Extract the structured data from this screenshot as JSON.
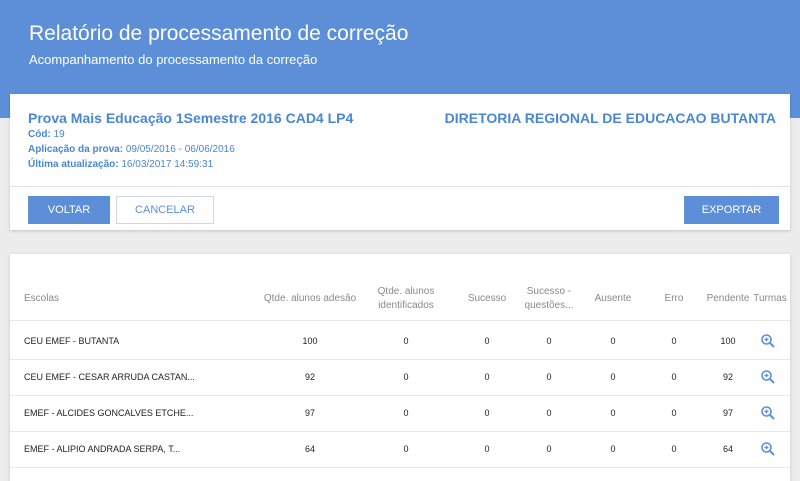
{
  "header": {
    "title": "Relatório de processamento de correção",
    "subtitle": "Acompanhamento do processamento da correção"
  },
  "exam": {
    "title": "Prova Mais Educação 1Semestre 2016 CAD4 LP4",
    "directorate": "DIRETORIA REGIONAL DE EDUCACAO BUTANTA",
    "code_label": "Cód:",
    "code_value": "19",
    "application_label": "Aplicação da prova:",
    "application_value": "09/05/2016 - 06/06/2016",
    "updated_label": "Última atualização:",
    "updated_value": "16/03/2017 14:59:31"
  },
  "actions": {
    "back_label": "VOLTAR",
    "cancel_label": "CANCELAR",
    "export_label": "EXPORTAR"
  },
  "table": {
    "columns": {
      "schools": "Escolas",
      "adhesion": "Qtde. alunos adesão",
      "identified": "Qtde. alunos identificados",
      "success": "Sucesso",
      "success_questions": "Sucesso - questões...",
      "absent": "Ausente",
      "error": "Erro",
      "pending": "Pendente",
      "classes": "Turmas"
    },
    "rows": [
      {
        "school": "CEU EMEF - BUTANTA",
        "adhesion": "100",
        "identified": "0",
        "success": "0",
        "success_questions": "0",
        "absent": "0",
        "error": "0",
        "pending": "100"
      },
      {
        "school": "CEU EMEF - CESAR ARRUDA CASTAN...",
        "adhesion": "92",
        "identified": "0",
        "success": "0",
        "success_questions": "0",
        "absent": "0",
        "error": "0",
        "pending": "92"
      },
      {
        "school": "EMEF - ALCIDES GONCALVES ETCHE...",
        "adhesion": "97",
        "identified": "0",
        "success": "0",
        "success_questions": "0",
        "absent": "0",
        "error": "0",
        "pending": "97"
      },
      {
        "school": "EMEF - ALIPIO ANDRADA SERPA, T...",
        "adhesion": "64",
        "identified": "0",
        "success": "0",
        "success_questions": "0",
        "absent": "0",
        "error": "0",
        "pending": "64"
      }
    ],
    "classes_icon": "zoom-in-icon"
  },
  "colors": {
    "accent": "#5d8fd9",
    "text_accent": "#4a86d6"
  }
}
